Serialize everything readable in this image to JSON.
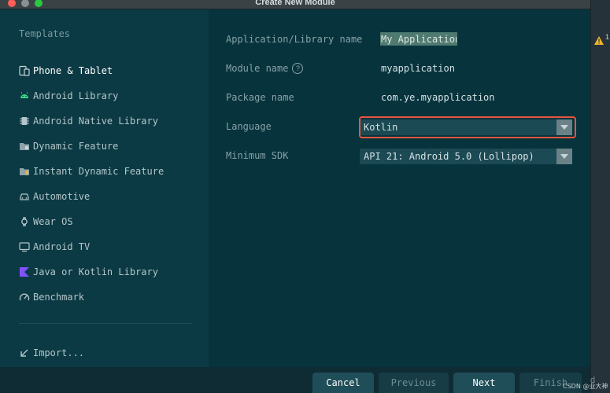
{
  "window": {
    "title": "Create New Module"
  },
  "sidebar": {
    "header": "Templates",
    "items": [
      {
        "label": "Phone & Tablet",
        "icon": "phone-tablet-icon",
        "selected": true
      },
      {
        "label": "Android Library",
        "icon": "android-icon"
      },
      {
        "label": "Android Native Library",
        "icon": "native-library-icon"
      },
      {
        "label": "Dynamic Feature",
        "icon": "dynamic-feature-icon"
      },
      {
        "label": "Instant Dynamic Feature",
        "icon": "instant-feature-icon"
      },
      {
        "label": "Automotive",
        "icon": "car-icon"
      },
      {
        "label": "Wear OS",
        "icon": "watch-icon"
      },
      {
        "label": "Android TV",
        "icon": "tv-icon"
      },
      {
        "label": "Java or Kotlin Library",
        "icon": "kotlin-icon"
      },
      {
        "label": "Benchmark",
        "icon": "gauge-icon"
      }
    ],
    "import_label": "Import..."
  },
  "form": {
    "app_name": {
      "label": "Application/Library name",
      "value": "My Application"
    },
    "module_name": {
      "label": "Module name",
      "value": "myapplication"
    },
    "package_name": {
      "label": "Package name",
      "value": "com.ye.myapplication"
    },
    "language": {
      "label": "Language",
      "value": "Kotlin"
    },
    "min_sdk": {
      "label": "Minimum SDK",
      "value": "API 21: Android 5.0 (Lollipop)"
    }
  },
  "footer": {
    "cancel": "Cancel",
    "previous": "Previous",
    "next": "Next",
    "finish": "Finish"
  },
  "notifications": {
    "warning_count": "1"
  },
  "watermark": "CSDN @业大神",
  "stray_text": "d",
  "colors": {
    "highlight_border": "#e8563f",
    "accent_kotlin": "#7f52ff"
  }
}
